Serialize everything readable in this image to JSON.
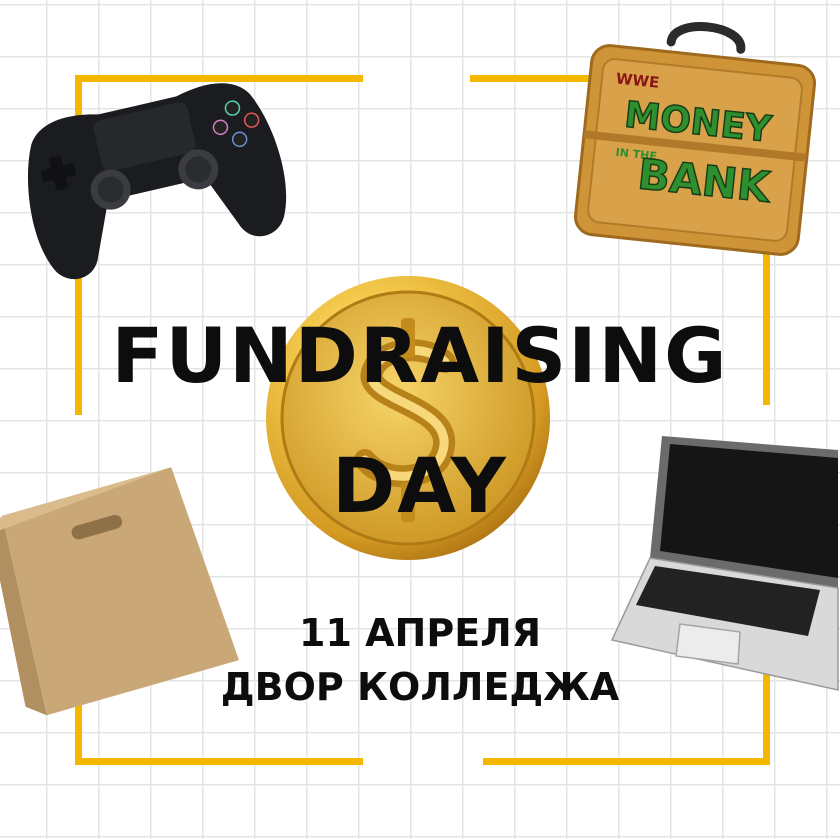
{
  "poster": {
    "title_line_1": "FUNDRAISING",
    "title_line_2": "DAY",
    "date": "11 АПРЕЛЯ",
    "location": "ДВОР КОЛЛЕДЖА",
    "briefcase_text": {
      "brand": "WWE",
      "line_1": "MONEY",
      "line_2": "IN THE",
      "line_3": "BANK"
    }
  },
  "colors": {
    "frame": "#f5b800",
    "coin": "#e0ac2c",
    "text": "#0d0d0d",
    "briefcase": "#d39a3f",
    "briefcase_text": "#2f8f2f"
  },
  "icons": [
    "gamepad-icon",
    "briefcase-icon",
    "coin-icon",
    "paper-bag-icon",
    "laptop-icon"
  ]
}
